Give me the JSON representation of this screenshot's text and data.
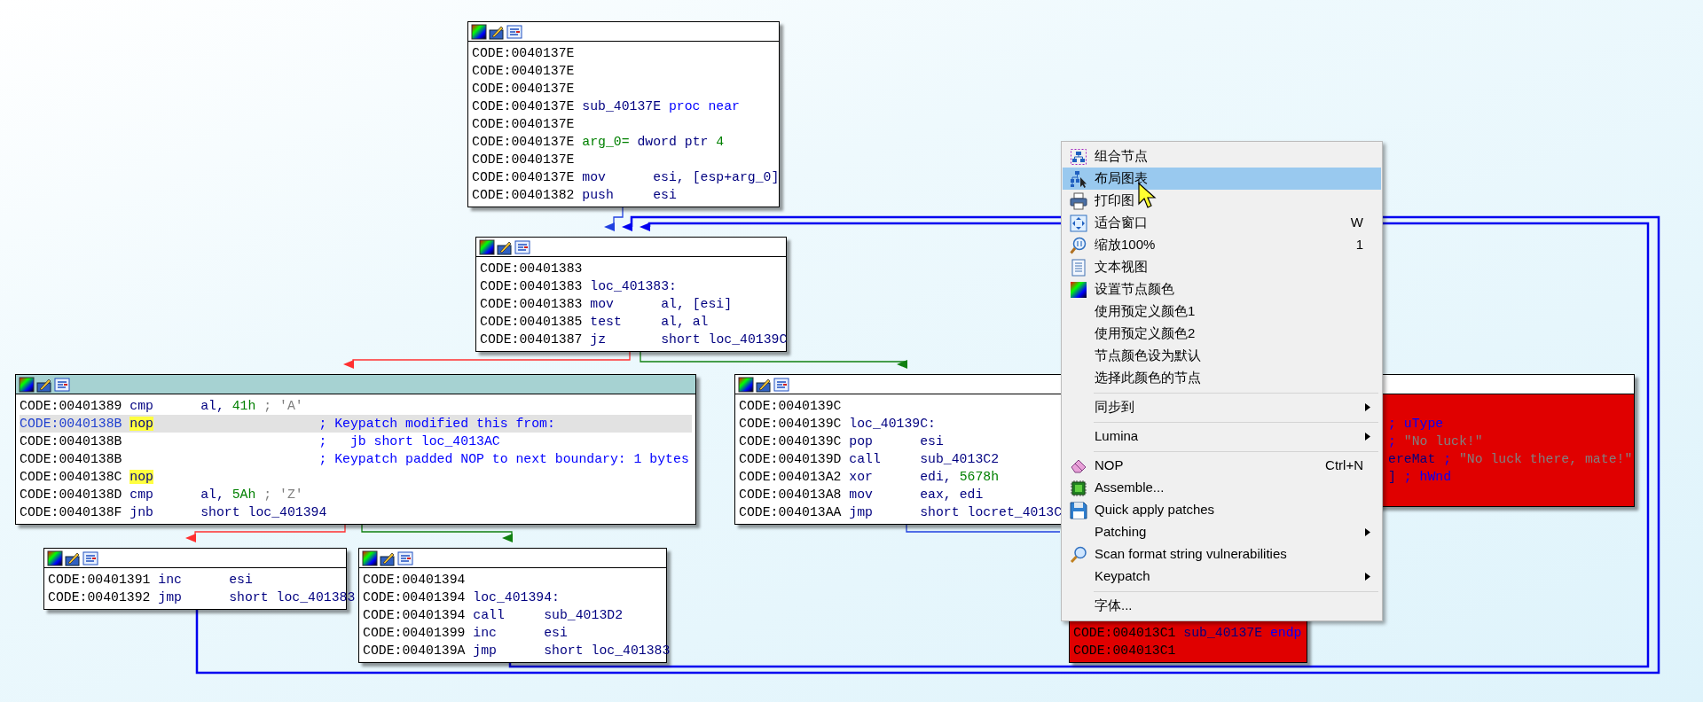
{
  "graph": {
    "nodes": [
      {
        "selected": false,
        "lines": [
          {
            "selected": false,
            "parts": [
              {
                "kind": "addr",
                "text": "CODE:0040137E"
              }
            ]
          },
          {
            "selected": false,
            "parts": [
              {
                "kind": "addr",
                "text": "CODE:0040137E"
              }
            ]
          },
          {
            "selected": false,
            "parts": [
              {
                "kind": "addr",
                "text": "CODE:0040137E"
              }
            ]
          },
          {
            "selected": false,
            "parts": [
              {
                "kind": "addr",
                "text": "CODE:0040137E"
              },
              {
                "kind": "ins",
                "text": "sub_40137E"
              },
              {
                "kind": "kw",
                "text": "proc near"
              }
            ]
          },
          {
            "selected": false,
            "parts": [
              {
                "kind": "addr",
                "text": "CODE:0040137E"
              }
            ]
          },
          {
            "selected": false,
            "parts": [
              {
                "kind": "addr",
                "text": "CODE:0040137E"
              },
              {
                "kind": "var",
                "text": "arg_0="
              },
              {
                "kind": "ins",
                "text": "dword ptr"
              },
              {
                "kind": "num",
                "text": "4"
              }
            ]
          },
          {
            "selected": false,
            "parts": [
              {
                "kind": "addr",
                "text": "CODE:0040137E"
              }
            ]
          },
          {
            "selected": false,
            "parts": [
              {
                "kind": "addr",
                "text": "CODE:0040137E"
              },
              {
                "kind": "mnem",
                "text": "mov"
              },
              {
                "kind": "ins",
                "text": "esi,"
              },
              {
                "kind": "ins",
                "text": "[esp+arg_0]"
              }
            ]
          },
          {
            "selected": false,
            "parts": [
              {
                "kind": "addr",
                "text": "CODE:00401382"
              },
              {
                "kind": "mnem",
                "text": "push"
              },
              {
                "kind": "ins",
                "text": "esi"
              }
            ]
          }
        ]
      },
      {
        "selected": false,
        "lines": [
          {
            "selected": false,
            "parts": [
              {
                "kind": "addr",
                "text": "CODE:00401383"
              }
            ]
          },
          {
            "selected": false,
            "parts": [
              {
                "kind": "addr",
                "text": "CODE:00401383"
              },
              {
                "kind": "ins",
                "text": "loc_401383:"
              }
            ]
          },
          {
            "selected": false,
            "parts": [
              {
                "kind": "addr",
                "text": "CODE:00401383"
              },
              {
                "kind": "mnem",
                "text": "mov"
              },
              {
                "kind": "ins",
                "text": "al,"
              },
              {
                "kind": "ins",
                "text": "[esi]"
              }
            ]
          },
          {
            "selected": false,
            "parts": [
              {
                "kind": "addr",
                "text": "CODE:00401385"
              },
              {
                "kind": "mnem",
                "text": "test"
              },
              {
                "kind": "ins",
                "text": "al,"
              },
              {
                "kind": "ins",
                "text": "al"
              }
            ]
          },
          {
            "selected": false,
            "parts": [
              {
                "kind": "addr",
                "text": "CODE:00401387"
              },
              {
                "kind": "mnem",
                "text": "jz"
              },
              {
                "kind": "ins",
                "text": "short loc_40139C"
              }
            ]
          }
        ]
      },
      {
        "selected": true,
        "lines": [
          {
            "selected": false,
            "parts": [
              {
                "kind": "addr",
                "text": "CODE:00401389"
              },
              {
                "kind": "mnem",
                "text": "cmp"
              },
              {
                "kind": "ins",
                "text": "al,"
              },
              {
                "kind": "num",
                "text": "41h"
              },
              {
                "kind": "str",
                "text": "; 'A'"
              }
            ]
          },
          {
            "selected": true,
            "parts": [
              {
                "kind": "addr",
                "text": "CODE:0040138B"
              },
              {
                "kind": "patch",
                "text": "nop"
              },
              {
                "kind": "acmt",
                "text": "; Keypatch modified this from:"
              }
            ]
          },
          {
            "selected": false,
            "parts": [
              {
                "kind": "addr",
                "text": "CODE:0040138B"
              },
              {
                "kind": "acmt",
                "text": ";   jb short loc_4013AC"
              }
            ]
          },
          {
            "selected": false,
            "parts": [
              {
                "kind": "addr",
                "text": "CODE:0040138B"
              },
              {
                "kind": "acmt",
                "text": "; Keypatch padded NOP to next boundary: 1 bytes"
              }
            ]
          },
          {
            "selected": false,
            "parts": [
              {
                "kind": "addr",
                "text": "CODE:0040138C"
              },
              {
                "kind": "patch",
                "text": "nop"
              }
            ]
          },
          {
            "selected": false,
            "parts": [
              {
                "kind": "addr",
                "text": "CODE:0040138D"
              },
              {
                "kind": "mnem",
                "text": "cmp"
              },
              {
                "kind": "ins",
                "text": "al,"
              },
              {
                "kind": "num",
                "text": "5Ah"
              },
              {
                "kind": "str",
                "text": "; 'Z'"
              }
            ]
          },
          {
            "selected": false,
            "parts": [
              {
                "kind": "addr",
                "text": "CODE:0040138F"
              },
              {
                "kind": "mnem",
                "text": "jnb"
              },
              {
                "kind": "ins",
                "text": "short loc_401394"
              }
            ]
          }
        ]
      },
      {
        "selected": false,
        "lines": [
          {
            "selected": false,
            "parts": [
              {
                "kind": "addr",
                "text": "CODE:00401391"
              },
              {
                "kind": "mnem",
                "text": "inc"
              },
              {
                "kind": "ins",
                "text": "esi"
              }
            ]
          },
          {
            "selected": false,
            "parts": [
              {
                "kind": "addr",
                "text": "CODE:00401392"
              },
              {
                "kind": "mnem",
                "text": "jmp"
              },
              {
                "kind": "ins",
                "text": "short loc_401383"
              }
            ]
          }
        ]
      },
      {
        "selected": false,
        "lines": [
          {
            "selected": false,
            "parts": [
              {
                "kind": "addr",
                "text": "CODE:00401394"
              }
            ]
          },
          {
            "selected": false,
            "parts": [
              {
                "kind": "addr",
                "text": "CODE:00401394"
              },
              {
                "kind": "ins",
                "text": "loc_401394:"
              }
            ]
          },
          {
            "selected": false,
            "parts": [
              {
                "kind": "addr",
                "text": "CODE:00401394"
              },
              {
                "kind": "mnem",
                "text": "call"
              },
              {
                "kind": "ins",
                "text": "sub_4013D2"
              }
            ]
          },
          {
            "selected": false,
            "parts": [
              {
                "kind": "addr",
                "text": "CODE:00401399"
              },
              {
                "kind": "mnem",
                "text": "inc"
              },
              {
                "kind": "ins",
                "text": "esi"
              }
            ]
          },
          {
            "selected": false,
            "parts": [
              {
                "kind": "addr",
                "text": "CODE:0040139A"
              },
              {
                "kind": "mnem",
                "text": "jmp"
              },
              {
                "kind": "ins",
                "text": "short loc_401383"
              }
            ]
          }
        ]
      },
      {
        "selected": false,
        "lines": [
          {
            "selected": false,
            "parts": [
              {
                "kind": "addr",
                "text": "CODE:0040139C"
              }
            ]
          },
          {
            "selected": false,
            "parts": [
              {
                "kind": "addr",
                "text": "CODE:0040139C"
              },
              {
                "kind": "ins",
                "text": "loc_40139C:"
              }
            ]
          },
          {
            "selected": false,
            "parts": [
              {
                "kind": "addr",
                "text": "CODE:0040139C"
              },
              {
                "kind": "mnem",
                "text": "pop"
              },
              {
                "kind": "ins",
                "text": "esi"
              }
            ]
          },
          {
            "selected": false,
            "parts": [
              {
                "kind": "addr",
                "text": "CODE:0040139D"
              },
              {
                "kind": "mnem",
                "text": "call"
              },
              {
                "kind": "ins",
                "text": "sub_4013C2"
              }
            ]
          },
          {
            "selected": false,
            "parts": [
              {
                "kind": "addr",
                "text": "CODE:004013A2"
              },
              {
                "kind": "mnem",
                "text": "xor"
              },
              {
                "kind": "ins",
                "text": "edi,"
              },
              {
                "kind": "num",
                "text": "5678h"
              }
            ]
          },
          {
            "selected": false,
            "parts": [
              {
                "kind": "addr",
                "text": "CODE:004013A8"
              },
              {
                "kind": "mnem",
                "text": "mov"
              },
              {
                "kind": "ins",
                "text": "eax,"
              },
              {
                "kind": "ins",
                "text": "edi"
              }
            ]
          },
          {
            "selected": false,
            "parts": [
              {
                "kind": "addr",
                "text": "CODE:004013AA"
              },
              {
                "kind": "mnem",
                "text": "jmp"
              },
              {
                "kind": "ins",
                "text": "short locret_4013C"
              }
            ]
          }
        ]
      },
      {
        "selected": false,
        "color": "#e00000",
        "lines": [
          {
            "selected": false,
            "parts": [
              {
                "kind": "cmt",
                "text": "; uType"
              }
            ]
          },
          {
            "selected": false,
            "parts": [
              {
                "kind": "cmt",
                "text": ";"
              },
              {
                "kind": "str",
                "text": "\"No luck!\""
              }
            ]
          },
          {
            "selected": false,
            "parts": [
              {
                "kind": "ins",
                "text": "ereMat"
              },
              {
                "kind": "cmt",
                "text": ";"
              },
              {
                "kind": "str",
                "text": "\"No luck there, mate!\""
              }
            ]
          },
          {
            "selected": false,
            "parts": [
              {
                "kind": "ins",
                "text": "]"
              },
              {
                "kind": "cmt",
                "text": "; hWnd"
              }
            ]
          }
        ]
      },
      {
        "color": "#e00000",
        "lines": [
          {
            "selected": false,
            "parts": [
              {
                "kind": "addr",
                "text": "CODE:004013C1"
              },
              {
                "kind": "ins",
                "text": "sub_40137E"
              },
              {
                "kind": "kw",
                "text": "endp"
              }
            ]
          },
          {
            "selected": false,
            "parts": [
              {
                "kind": "addr",
                "text": "CODE:004013C1"
              }
            ]
          }
        ]
      }
    ]
  },
  "context_menu": {
    "items": [
      {
        "kind": "item",
        "label": "组合节点",
        "selected": false
      },
      {
        "kind": "item",
        "label": "布局图表",
        "selected": true
      },
      {
        "kind": "item",
        "label": "打印图",
        "selected": false
      },
      {
        "kind": "item",
        "label": "适合窗口",
        "shortcut": "W",
        "selected": false
      },
      {
        "kind": "item",
        "label": "缩放100%",
        "shortcut": "1",
        "selected": false
      },
      {
        "kind": "item",
        "label": "文本视图",
        "selected": false
      },
      {
        "kind": "item",
        "label": "设置节点颜色",
        "selected": false
      },
      {
        "kind": "item",
        "label": "使用预定义颜色1",
        "selected": false
      },
      {
        "kind": "item",
        "label": "使用预定义颜色2",
        "selected": false
      },
      {
        "kind": "item",
        "label": "节点颜色设为默认",
        "selected": false
      },
      {
        "kind": "item",
        "label": "选择此颜色的节点",
        "selected": false
      },
      {
        "kind": "separator"
      },
      {
        "kind": "item",
        "label": "同步到",
        "submenu": true,
        "selected": false
      },
      {
        "kind": "separator"
      },
      {
        "kind": "item",
        "label": "Lumina",
        "submenu": true,
        "selected": false
      },
      {
        "kind": "separator"
      },
      {
        "kind": "item",
        "label": "NOP",
        "shortcut": "Ctrl+N",
        "selected": false
      },
      {
        "kind": "item",
        "label": "Assemble...",
        "selected": false
      },
      {
        "kind": "item",
        "label": "Quick apply patches",
        "selected": false
      },
      {
        "kind": "item",
        "label": "Patching",
        "submenu": true,
        "selected": false
      },
      {
        "kind": "item",
        "label": "Scan format string vulnerabilities",
        "selected": false
      },
      {
        "kind": "item",
        "label": "Keypatch",
        "submenu": true,
        "selected": false
      },
      {
        "kind": "separator"
      },
      {
        "kind": "item",
        "label": "字体...",
        "selected": false
      }
    ]
  }
}
